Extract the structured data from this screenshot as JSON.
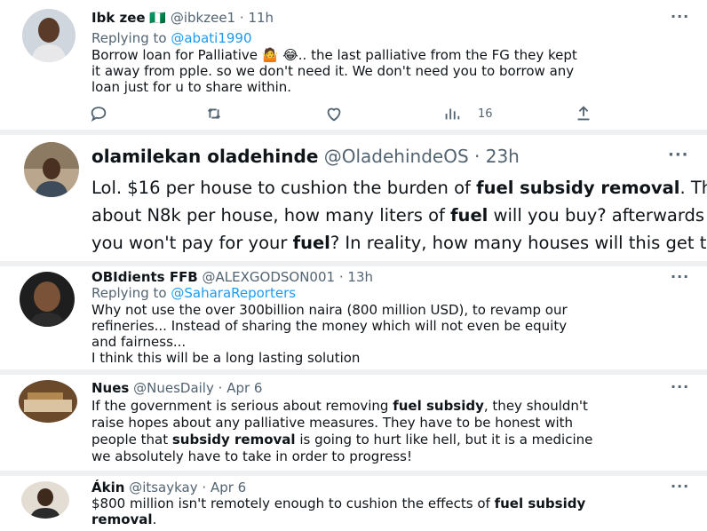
{
  "tweets": [
    {
      "name": "Ibk zee",
      "flag": "🇳🇬",
      "handle": "@ibkzee1",
      "time": "11h",
      "replying_label": "Replying to",
      "replying_to": "@abati1990",
      "lines": [
        "Borrow loan for Palliative 🤷 😂.. the last palliative from the FG they kept",
        "it away from pple. so we don't need it. We don't need you to borrow any",
        "loan  just for u to share within."
      ],
      "views": "16"
    },
    {
      "name": "olamilekan oladehinde",
      "handle": "@OladehindeOS",
      "time": "23h",
      "l1_a": "Lol. $16 per house to cushion the burden of ",
      "l1_b": "fuel subsidy removal",
      "l1_c": ". That's",
      "l2_a": "about N8k per house, how many liters of ",
      "l2_b": "fuel",
      "l2_c": " will you buy? afterwards",
      "l3_a": "you won't pay for your ",
      "l3_b": "fuel",
      "l3_c": "? In reality, how many houses will this get to?"
    },
    {
      "name": "OBIdients FFB",
      "handle": "@ALEXGODSON001",
      "time": "13h",
      "replying_label": "Replying to",
      "replying_to": "@SaharaReporters",
      "lines": [
        "Why not use the over 300billion naira (800 million USD), to revamp our",
        "refineries... Instead of sharing the money which will not even be equity",
        "and fairness...",
        "I think this will be a long lasting solution"
      ]
    },
    {
      "name": "Nues",
      "handle": "@NuesDaily",
      "time": "Apr 6",
      "l1_a": "If the government is serious about removing ",
      "l1_b": "fuel subsidy",
      "l1_c": ", they shouldn't",
      "l2": "raise hopes about any palliative measures. They have to be honest with",
      "l3_a": "people that ",
      "l3_b": "subsidy removal",
      "l3_c": " is going to hurt like hell, but it is a medicine",
      "l4": "we absolutely have to take in order to progress!"
    },
    {
      "name": "Ákin",
      "handle": "@itsaykay",
      "time": "Apr 6",
      "l1_a": "$800 million isn't remotely enough to cushion the effects of ",
      "l1_b": "fuel subsidy",
      "l2_b": "removal",
      "l2_c": "."
    }
  ],
  "dot": "·",
  "more_label": "···",
  "colors": {
    "link": "#1d9bf0",
    "muted": "#536471",
    "text": "#0f1419",
    "separator": "#eef0f1"
  },
  "icons": [
    "reply-icon",
    "retweet-icon",
    "like-icon",
    "views-icon",
    "share-icon",
    "more-icon"
  ]
}
